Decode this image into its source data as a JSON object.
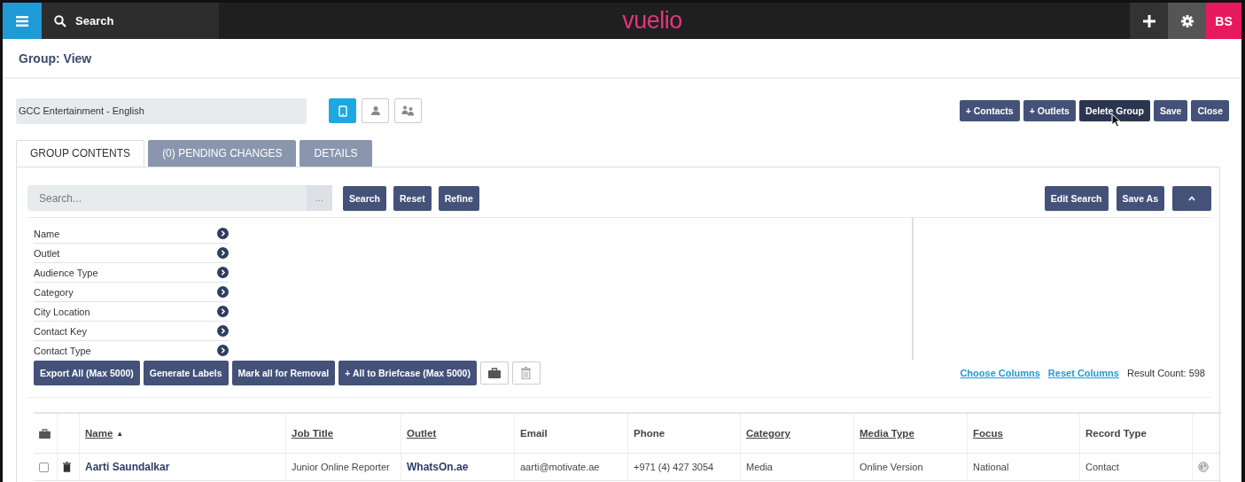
{
  "topbar": {
    "search_label": "Search",
    "logo": "vuelio",
    "avatar": "BS"
  },
  "page_title": "Group: View",
  "group_name": {
    "value": "GCC Entertainment - English"
  },
  "view_toggles": [
    {
      "kind": "tablet",
      "selected": true
    },
    {
      "kind": "person",
      "selected": false
    },
    {
      "kind": "people",
      "selected": false
    }
  ],
  "actions": [
    {
      "label": "+ Contacts",
      "hovered": false
    },
    {
      "label": "+ Outlets",
      "hovered": false
    },
    {
      "label": "Delete Group",
      "hovered": true
    },
    {
      "label": "Save",
      "hovered": false
    },
    {
      "label": "Close",
      "hovered": false
    }
  ],
  "tabs": [
    {
      "label": "GROUP CONTENTS",
      "selected": true
    },
    {
      "label": "(0) PENDING CHANGES",
      "selected": false
    },
    {
      "label": "DETAILS",
      "selected": false
    }
  ],
  "search": {
    "placeholder": "Search...",
    "addon": "...",
    "buttons": [
      "Search",
      "Reset",
      "Refine"
    ],
    "right_buttons": [
      "Edit Search",
      "Save As"
    ]
  },
  "filters": [
    "Name",
    "Outlet",
    "Audience Type",
    "Category",
    "City Location",
    "Contact Key",
    "Contact Type"
  ],
  "bulk_buttons": [
    "Export All (Max 5000)",
    "Generate Labels",
    "Mark all for Removal",
    "+ All to Briefcase (Max 5000)"
  ],
  "links": [
    "Choose Columns",
    "Reset Columns"
  ],
  "result_count": "Result Count: 598",
  "table": {
    "columns": [
      {
        "label": "Name",
        "sortable": true,
        "sort_mark": "▲"
      },
      {
        "label": "Job Title",
        "sortable": true
      },
      {
        "label": "Outlet",
        "sortable": true
      },
      {
        "label": "Email",
        "sortable": false
      },
      {
        "label": "Phone",
        "sortable": false
      },
      {
        "label": "Category",
        "sortable": true
      },
      {
        "label": "Media Type",
        "sortable": true
      },
      {
        "label": "Focus",
        "sortable": true
      },
      {
        "label": "Record Type",
        "sortable": false
      }
    ],
    "rows": [
      {
        "checked": false,
        "cells": [
          "Aarti Saundalkar",
          "Junior Online Reporter",
          "WhatsOn.ae",
          "aarti@motivate.ae",
          "+971 (4) 427 3054",
          "Media",
          "Online Version",
          "National",
          "Contact"
        ]
      }
    ]
  }
}
